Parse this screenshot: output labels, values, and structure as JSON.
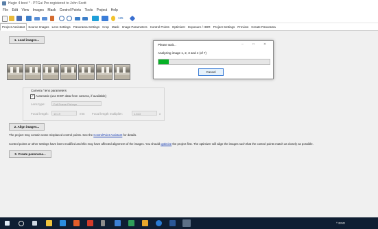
{
  "window": {
    "title": "Hugin 4 boot * - PTGui Pro registered to John Scott"
  },
  "menu": [
    "File",
    "Edit",
    "View",
    "Images",
    "Mask",
    "Control Points",
    "Tools",
    "Project",
    "Help"
  ],
  "toolbar": {
    "icons": [
      "new-project-icon",
      "open-icon",
      "save-icon",
      "add-images-icon",
      "undo-icon",
      "redo-icon",
      "optimize-icon",
      "zoom-in-icon",
      "zoom-out-icon",
      "previous-icon",
      "next-icon",
      "panorama-editor-icon",
      "table-icon",
      "light-icon",
      "control-points-icon",
      "help-icon"
    ],
    "counter": "125"
  },
  "tabs": {
    "items": [
      "Project Assistant",
      "Source Images",
      "Lens Settings",
      "Panorama Settings",
      "Crop",
      "Mask",
      "Image Parameters",
      "Control Points",
      "Optimizer",
      "Exposure / HDR",
      "Project Settings",
      "Preview",
      "Create Panorama"
    ],
    "active": "Project Assistant"
  },
  "main": {
    "load_button": "1. Load images...",
    "camera": {
      "group_label": "Camera / lens parameters",
      "auto_checkbox_label": "Automatic (use EXIF data from camera, if available)",
      "auto_checked": true,
      "lens_type_label": "Lens type:",
      "lens_type_value": "Full Frame Fisheye",
      "focal_length_label": "Focal length:",
      "focal_length_value": "10.19",
      "focal_length_unit": "mm",
      "multiplier_label": "Focal length multiplier:",
      "multiplier_value": "1.613",
      "multiplier_unit": "x"
    },
    "align_button": "2. Align images...",
    "note1_prefix": "The project may contain some misplaced control points. See the ",
    "note1_link": "ControlPoint Assistant",
    "note1_suffix": " for details.",
    "note2_prefix": "Control points or other settings have been modified and this may have affected alignment of the images. You should ",
    "note2_link": "optimize",
    "note2_suffix": " the project first. The optimizer will align the images such that the control points match as closely as possible.",
    "create_button": "3. Create panorama..."
  },
  "dialog": {
    "title": "Please wait...",
    "message": "Analyzing image 1, 2, 3 and 4 (of 7)",
    "progress": 0.09,
    "progress_color": "#06b025",
    "cancel_label": "Cancel"
  },
  "taskbar": {
    "icons": [
      "windows-start-icon",
      "search-icon",
      "task-view-icon",
      "file-explorer-icon",
      "mail-icon",
      "store-icon",
      "office-icon",
      "calculator-icon",
      "photos-icon",
      "app-icon",
      "chrome-icon",
      "word-icon",
      "hugin-icon"
    ],
    "tray_text": "^ ENG"
  }
}
